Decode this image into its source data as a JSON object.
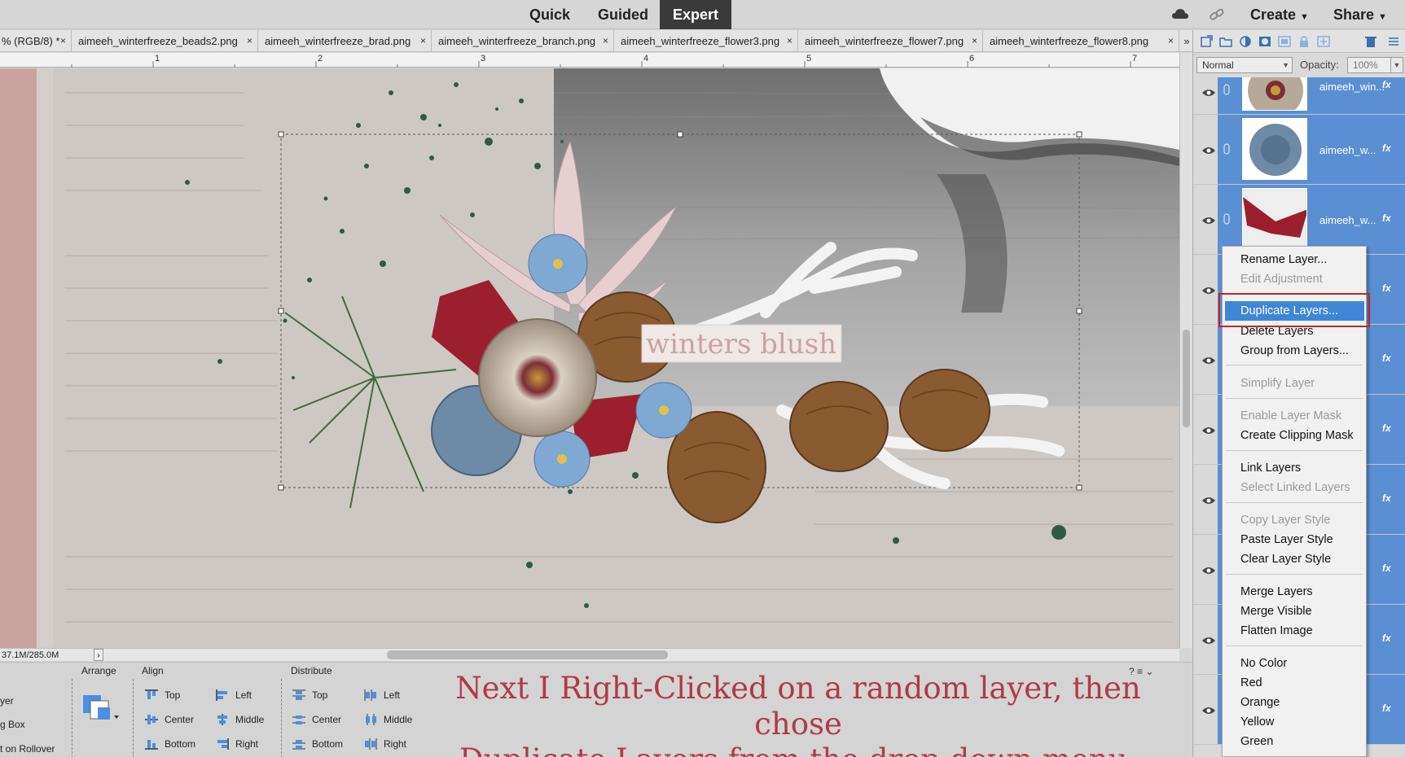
{
  "modebar": {
    "modes": [
      "Quick",
      "Guided",
      "Expert"
    ],
    "active_mode": "Expert",
    "create_label": "Create",
    "share_label": "Share"
  },
  "doc_tabs": [
    {
      "label": "% (RGB/8) *",
      "close": "×"
    },
    {
      "label": "aimeeh_winterfreeze_beads2.png",
      "close": "×"
    },
    {
      "label": "aimeeh_winterfreeze_brad.png",
      "close": "×"
    },
    {
      "label": "aimeeh_winterfreeze_branch.png",
      "close": "×"
    },
    {
      "label": "aimeeh_winterfreeze_flower3.png",
      "close": "×"
    },
    {
      "label": "aimeeh_winterfreeze_flower7.png",
      "close": "×"
    },
    {
      "label": "aimeeh_winterfreeze_flower8.png",
      "close": "×"
    }
  ],
  "tabs_overflow": "»",
  "ruler": {
    "numbers": [
      "1",
      "2",
      "3",
      "4",
      "5",
      "6",
      "7"
    ]
  },
  "canvas": {
    "title_text": "winters blush",
    "accent_colors": {
      "paper": "#cfcac6",
      "pink_strip": "#c9a3a0",
      "water": "#9a9a9a",
      "berry_red": "#9b1f2c",
      "blue_flower": "#7fa8d2",
      "pine_green": "#2f5a44"
    }
  },
  "status": {
    "text": "37.1M/285.0M",
    "arrow": "›"
  },
  "options": {
    "left_partial": [
      "yer",
      "g Box",
      "t on Rollover"
    ],
    "arrange_label": "Arrange",
    "align_label": "Align",
    "distribute_label": "Distribute",
    "align_items": [
      "Top",
      "Center",
      "Bottom",
      "Left",
      "Middle",
      "Right"
    ],
    "distribute_items": [
      "Top",
      "Center",
      "Bottom",
      "Left",
      "Middle",
      "Right"
    ],
    "caption_line1": "Next I Right-Clicked on a random layer, then chose",
    "caption_line2": "Duplicate Layers from the drop-down menu.",
    "help_icons": "? ≡ ⌄"
  },
  "layers": {
    "blend_mode": "Normal",
    "opacity_label": "Opacity:",
    "opacity_value": "100%",
    "rows": [
      {
        "name": "aimeeh_win...",
        "fx": "fx",
        "thumb": "flower-cream"
      },
      {
        "name": "aimeeh_w...",
        "fx": "fx",
        "thumb": "flower-blue"
      },
      {
        "name": "aimeeh_w...",
        "fx": "fx",
        "thumb": "ribbon-red"
      },
      {
        "name": "",
        "fx": "fx",
        "thumb": ""
      },
      {
        "name": "",
        "fx": "fx",
        "thumb": ""
      },
      {
        "name": "",
        "fx": "fx",
        "thumb": ""
      },
      {
        "name": "",
        "fx": "fx",
        "thumb": ""
      },
      {
        "name": "",
        "fx": "fx",
        "thumb": ""
      },
      {
        "name": "",
        "fx": "fx",
        "thumb": ""
      },
      {
        "name": "",
        "fx": "fx",
        "thumb": ""
      }
    ]
  },
  "context_menu": {
    "items": [
      {
        "label": "Rename Layer...",
        "enabled": true
      },
      {
        "label": "Edit Adjustment",
        "enabled": false
      },
      {
        "label": "Duplicate Layers...",
        "enabled": true,
        "highlighted": true
      },
      {
        "label": "Delete Layers",
        "enabled": true
      },
      {
        "label": "Group from Layers...",
        "enabled": true
      },
      {
        "label": "Simplify Layer",
        "enabled": false
      },
      {
        "label": "Enable Layer Mask",
        "enabled": false
      },
      {
        "label": "Create Clipping Mask",
        "enabled": true
      },
      {
        "label": "Link Layers",
        "enabled": true
      },
      {
        "label": "Select Linked Layers",
        "enabled": false
      },
      {
        "label": "Copy Layer Style",
        "enabled": false
      },
      {
        "label": "Paste Layer Style",
        "enabled": true
      },
      {
        "label": "Clear Layer Style",
        "enabled": true
      },
      {
        "label": "Merge Layers",
        "enabled": true
      },
      {
        "label": "Merge Visible",
        "enabled": true
      },
      {
        "label": "Flatten Image",
        "enabled": true
      },
      {
        "label": "No Color",
        "enabled": true
      },
      {
        "label": "Red",
        "enabled": true
      },
      {
        "label": "Orange",
        "enabled": true
      },
      {
        "label": "Yellow",
        "enabled": true
      },
      {
        "label": "Green",
        "enabled": true
      }
    ],
    "highlight_box_color": "#c4232f"
  }
}
